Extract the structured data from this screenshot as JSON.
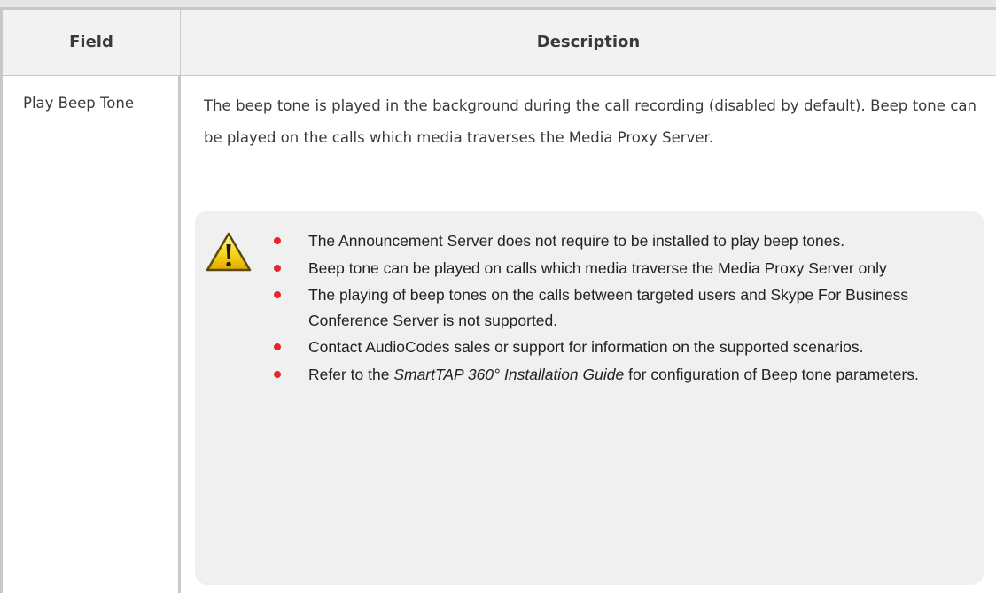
{
  "table": {
    "headers": {
      "field": "Field",
      "description": "Description"
    },
    "row": {
      "field": "Play Beep Tone",
      "description": "The beep tone is played in the background during the call recording (disabled by default). Beep tone can be played on the calls which media traverses the Media Proxy Server."
    }
  },
  "note": {
    "icon": "warning-icon",
    "bullet_color": "#e8262a",
    "items": [
      "The Announcement Server does not require to be installed to play beep tones.",
      "Beep tone can be played on calls which media traverse the Media Proxy Server only",
      "The playing of beep tones on the calls between targeted users and Skype For Business Conference Server is not supported.",
      "Contact AudioCodes sales or support for information on the supported scenarios."
    ],
    "last_item": {
      "prefix": "Refer to the ",
      "guide_title": "SmartTAP 360° Installation Guide",
      "suffix": " for configuration of Beep tone parameters."
    }
  }
}
